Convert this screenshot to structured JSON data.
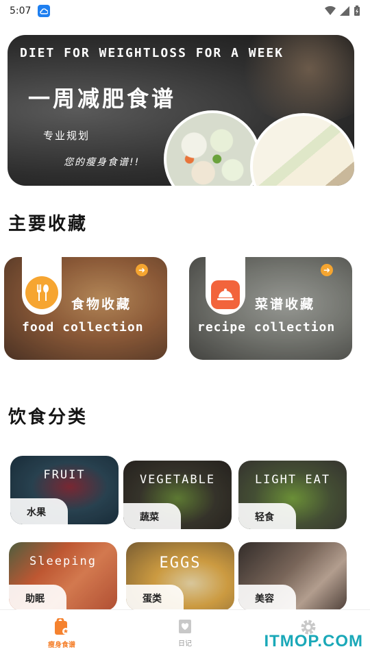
{
  "status_bar": {
    "time": "5:07"
  },
  "banner": {
    "title_en": "DIET FOR WEIGHTLOSS FOR A WEEK",
    "title_cn": "一周减肥食谱",
    "subtitle": "专业规划",
    "tagline": "您的瘦身食谱!!"
  },
  "sections": {
    "main_collection": "主要收藏",
    "diet_category": "饮食分类"
  },
  "collections": [
    {
      "name_cn": "食物收藏",
      "name_en": "food collection",
      "icon": "fork-spoon-icon"
    },
    {
      "name_cn": "菜谱收藏",
      "name_en": "recipe collection",
      "icon": "cloche-icon"
    }
  ],
  "categories": [
    {
      "en": "FRUIT",
      "cn": "水果"
    },
    {
      "en": "VEGETABLE",
      "cn": "蔬菜"
    },
    {
      "en": "LIGHT EAT",
      "cn": "轻食"
    },
    {
      "en": "Sleeping",
      "cn": "助眠"
    },
    {
      "en": "EGGS",
      "cn": "蛋类"
    },
    {
      "en": "",
      "cn": "美容"
    }
  ],
  "bottom_nav": [
    {
      "label": "瘦身食谱",
      "icon": "recipe-book-icon",
      "active": true
    },
    {
      "label": "日记",
      "icon": "diary-icon",
      "active": false
    },
    {
      "label": "",
      "icon": "gear-icon",
      "active": false
    }
  ],
  "watermark": "ITMOP.COM",
  "colors": {
    "accent": "#f5822f",
    "highlight": "#f7b440",
    "watermark": "#1aa8b8"
  }
}
